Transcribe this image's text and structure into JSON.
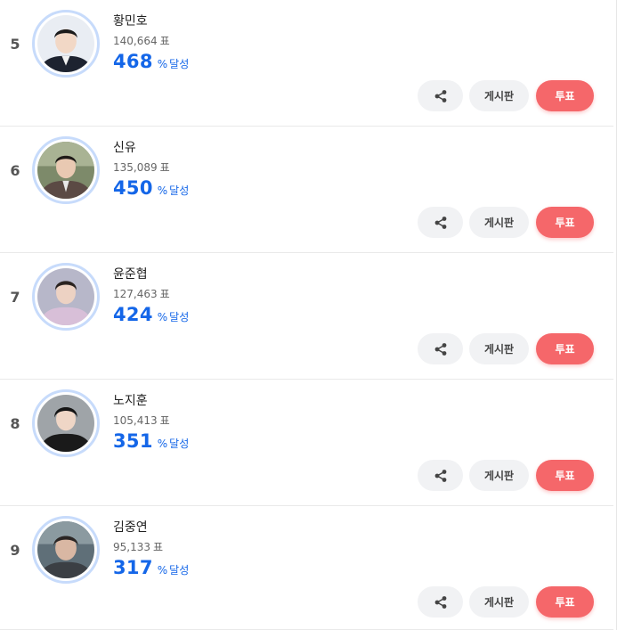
{
  "candidates": [
    {
      "rank": "5",
      "name": "황민호",
      "votes": "140,664",
      "votes_unit": "표",
      "percent": "468",
      "percent_sign": "%",
      "achieve_text": "달성",
      "share_icon": "share-icon",
      "board_label": "게시판",
      "vote_label": "투표"
    },
    {
      "rank": "6",
      "name": "신유",
      "votes": "135,089",
      "votes_unit": "표",
      "percent": "450",
      "percent_sign": "%",
      "achieve_text": "달성",
      "share_icon": "share-icon",
      "board_label": "게시판",
      "vote_label": "투표"
    },
    {
      "rank": "7",
      "name": "윤준협",
      "votes": "127,463",
      "votes_unit": "표",
      "percent": "424",
      "percent_sign": "%",
      "achieve_text": "달성",
      "share_icon": "share-icon",
      "board_label": "게시판",
      "vote_label": "투표"
    },
    {
      "rank": "8",
      "name": "노지훈",
      "votes": "105,413",
      "votes_unit": "표",
      "percent": "351",
      "percent_sign": "%",
      "achieve_text": "달성",
      "share_icon": "share-icon",
      "board_label": "게시판",
      "vote_label": "투표"
    },
    {
      "rank": "9",
      "name": "김중연",
      "votes": "95,133",
      "votes_unit": "표",
      "percent": "317",
      "percent_sign": "%",
      "achieve_text": "달성",
      "share_icon": "share-icon",
      "board_label": "게시판",
      "vote_label": "투표"
    }
  ],
  "colors": {
    "accent_blue": "#1466e8",
    "vote_button": "#f5676a",
    "avatar_ring": "#c7dbfb",
    "secondary_button": "#f1f2f4"
  }
}
